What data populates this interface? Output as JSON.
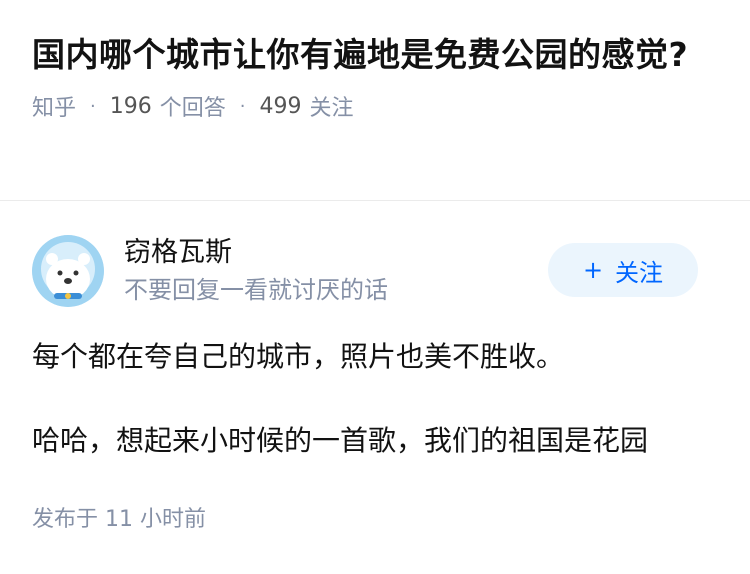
{
  "question": {
    "title": "国内哪个城市让你有遍地是免费公园的感觉?",
    "source": "知乎",
    "answer_count": "196",
    "answer_label": "个回答",
    "follow_count": "499",
    "follow_label": "关注"
  },
  "answer": {
    "author_name": "窃格瓦斯",
    "author_bio": "不要回复一看就讨厌的话",
    "follow_button_label": "关注",
    "paragraph_1": "每个都在夸自己的城市，照片也美不胜收。",
    "paragraph_2": "哈哈，想起来小时候的一首歌，我们的祖国是花园",
    "published_prefix": "发布于",
    "published_time": "11 小时前"
  },
  "colors": {
    "accent": "#0066ff",
    "muted": "#8590a6",
    "follow_bg": "#ebf5fd"
  }
}
